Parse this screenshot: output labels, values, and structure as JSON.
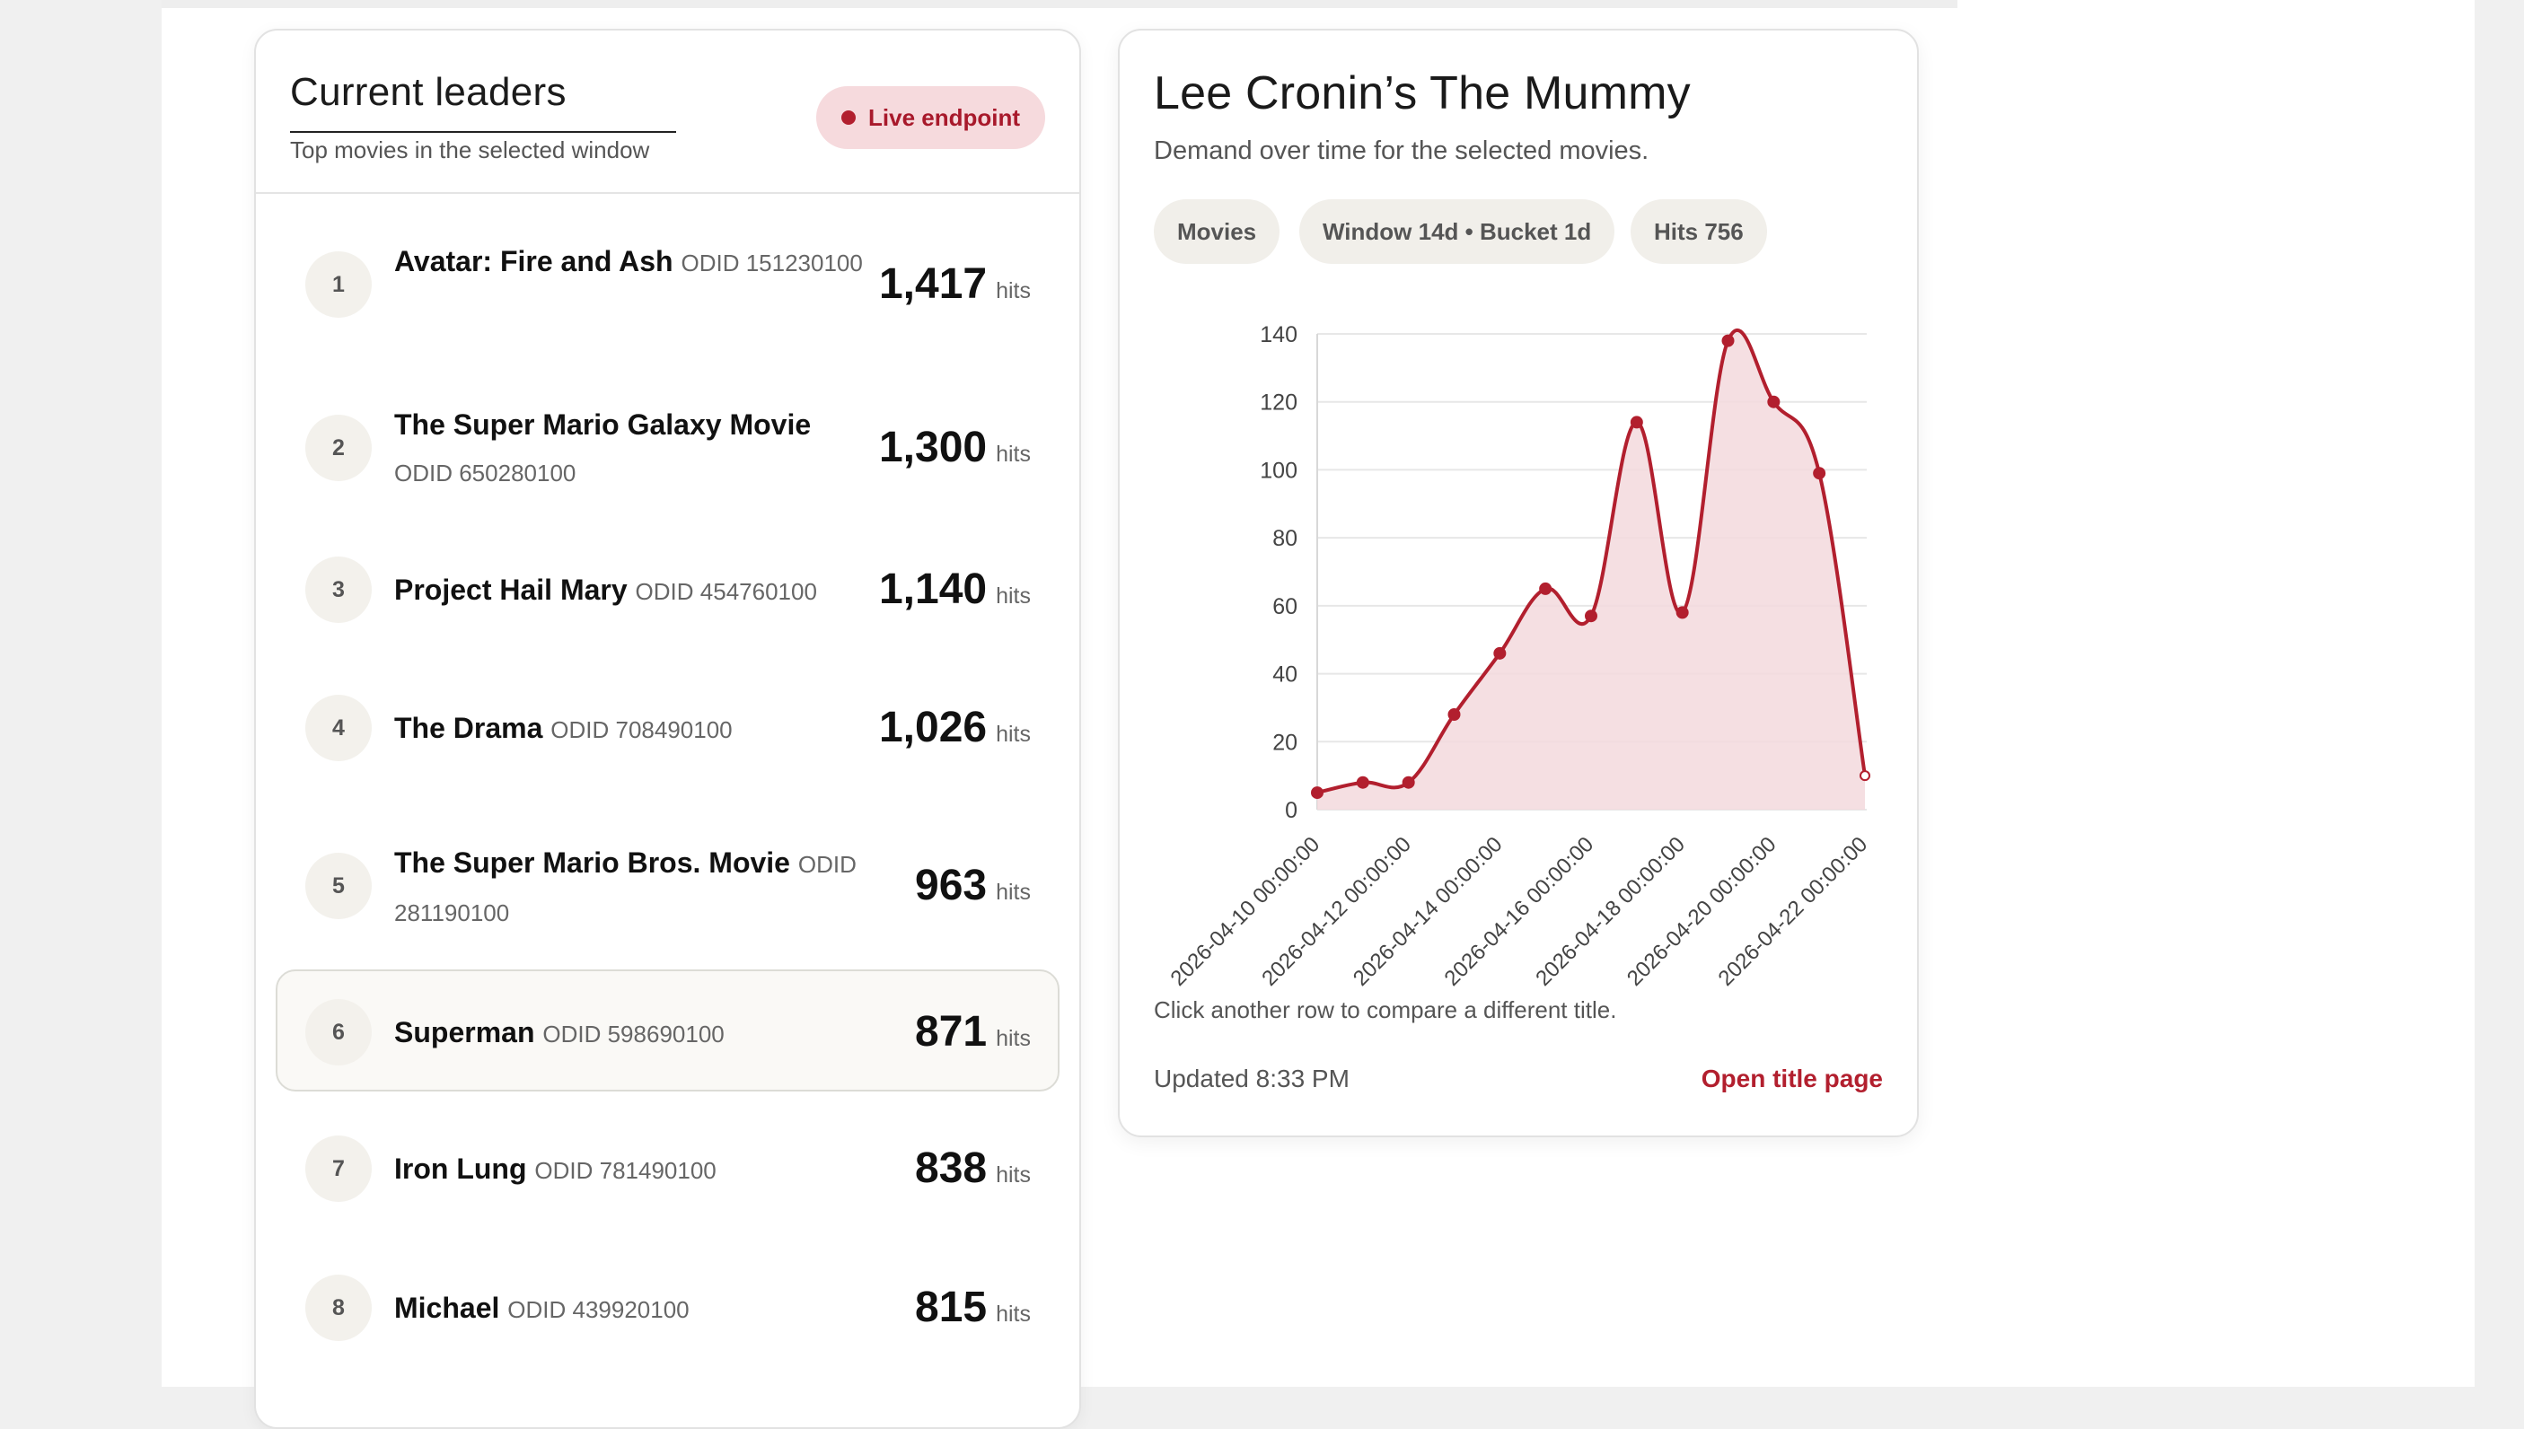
{
  "leaders": {
    "title": "Current leaders",
    "subtitle": "Top movies in the selected window",
    "badge": "Live endpoint",
    "hits_unit": "hits",
    "rows": [
      {
        "rank": "1",
        "name": "Avatar: Fire and Ash",
        "odid": "ODID 151230100",
        "hits": "1,417",
        "selected": false
      },
      {
        "rank": "2",
        "name": "The Super Mario Galaxy Movie",
        "odid": "ODID 650280100",
        "hits": "1,300",
        "selected": false
      },
      {
        "rank": "3",
        "name": "Project Hail Mary",
        "odid": "ODID 454760100",
        "hits": "1,140",
        "selected": false
      },
      {
        "rank": "4",
        "name": "The Drama",
        "odid": "ODID 708490100",
        "hits": "1,026",
        "selected": false
      },
      {
        "rank": "5",
        "name": "The Super Mario Bros. Movie",
        "odid": "ODID 281190100",
        "hits": "963",
        "selected": false
      },
      {
        "rank": "6",
        "name": "Superman",
        "odid": "ODID 598690100",
        "hits": "871",
        "selected": true
      },
      {
        "rank": "7",
        "name": "Iron Lung",
        "odid": "ODID 781490100",
        "hits": "838",
        "selected": false
      },
      {
        "rank": "8",
        "name": "Michael",
        "odid": "ODID 439920100",
        "hits": "815",
        "selected": false
      }
    ]
  },
  "detail": {
    "title": "Lee Cronin’s The Mummy",
    "subtitle": "Demand over time for the selected movies.",
    "pills": [
      "Movies",
      "Window 14d • Bucket 1d",
      "Hits 756"
    ],
    "footnote": "Click another row to compare a different title.",
    "updated": "Updated 8:33 PM",
    "open_link": "Open title page"
  },
  "colors": {
    "accent": "#b21f2e",
    "accent_fill": "#f3d9dd",
    "badge_bg": "#f6dadd"
  },
  "chart_data": {
    "type": "area",
    "title": "",
    "xlabel": "",
    "ylabel": "",
    "ylim": [
      0,
      140
    ],
    "yticks": [
      0,
      20,
      40,
      60,
      80,
      100,
      120,
      140
    ],
    "xtick_labels": [
      "2026-04-10 00:00:00",
      "2026-04-12 00:00:00",
      "2026-04-14 00:00:00",
      "2026-04-16 00:00:00",
      "2026-04-18 00:00:00",
      "2026-04-20 00:00:00",
      "2026-04-22 00:00:00"
    ],
    "x": [
      "2026-04-10 00:00:00",
      "2026-04-11 00:00:00",
      "2026-04-12 00:00:00",
      "2026-04-13 00:00:00",
      "2026-04-14 00:00:00",
      "2026-04-15 00:00:00",
      "2026-04-16 00:00:00",
      "2026-04-17 00:00:00",
      "2026-04-18 00:00:00",
      "2026-04-19 00:00:00",
      "2026-04-20 00:00:00",
      "2026-04-21 00:00:00",
      "2026-04-22 00:00:00"
    ],
    "series": [
      {
        "values": [
          5,
          8,
          8,
          28,
          46,
          65,
          57,
          114,
          58,
          138,
          120,
          99,
          10
        ]
      }
    ],
    "grid": true,
    "legend": "none"
  }
}
